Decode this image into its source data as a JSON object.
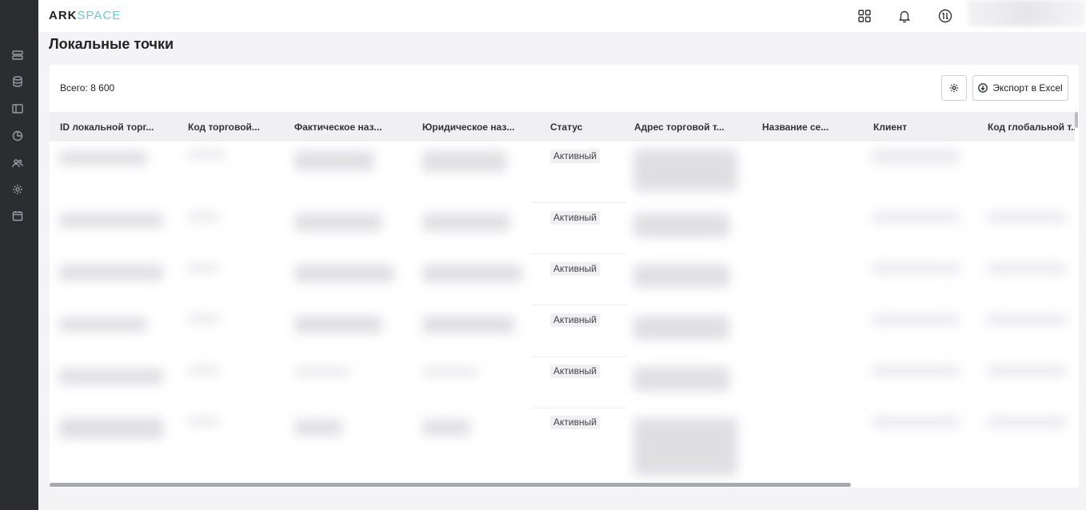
{
  "app": {
    "logo_bold": "ARK",
    "logo_light": "SPACE"
  },
  "sidebar": {
    "icons": [
      "server-icon",
      "database-icon",
      "panel-icon",
      "chart-pie-icon",
      "users-icon",
      "gear-icon",
      "calendar-icon"
    ]
  },
  "header": {
    "icons": [
      "grid-apps-icon",
      "bell-icon",
      "sync-icon"
    ]
  },
  "page": {
    "title": "Локальные точки"
  },
  "toolbar": {
    "total_label": "Всего: 8 600",
    "export_label": "Экспорт в Excel"
  },
  "table": {
    "columns": [
      "ID локальной торг...",
      "Код торговой...",
      "Фактическое наз...",
      "Юридическое наз...",
      "Статус",
      "Адрес торговой т...",
      "Название се...",
      "Клиент",
      "Код глобальной т..."
    ],
    "rows": [
      {
        "status": "Активный"
      },
      {
        "status": "Активный"
      },
      {
        "status": "Активный"
      },
      {
        "status": "Активный"
      },
      {
        "status": "Активный"
      },
      {
        "status": "Активный"
      }
    ]
  }
}
